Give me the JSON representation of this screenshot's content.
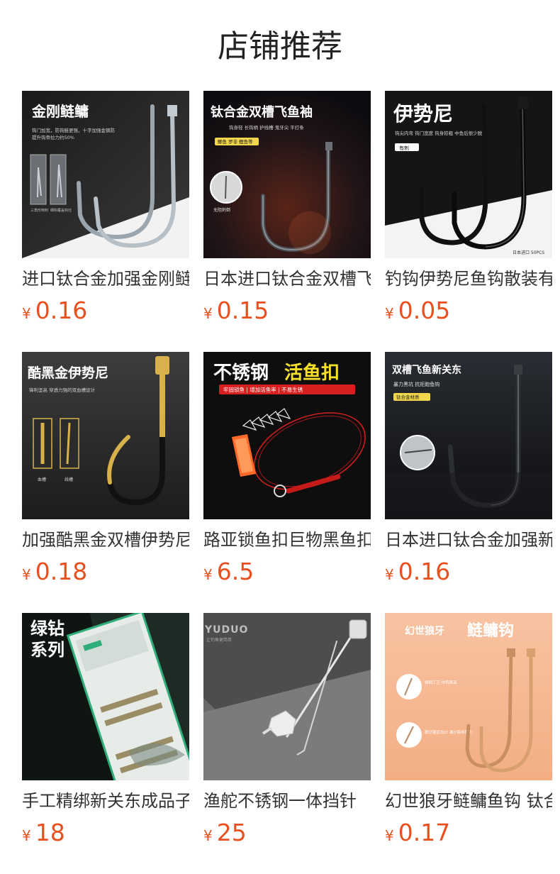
{
  "page": {
    "title": "店铺推荐",
    "currency_symbol": "¥"
  },
  "products": [
    {
      "name": "进口钛合金加强金刚鲢鳙",
      "price": "0.16",
      "image": {
        "title": "金刚鲢鳙",
        "subtitle_1": "钩门加宽，防钩鲢更强，十字加强金钢防",
        "subtitle_2": "提升钩骨拉力约50%",
        "callout_left": "三角形倒刺",
        "callout_right": "细钩覆盖钩坯",
        "colors": {
          "bg": "#1c1c1c",
          "accent": "#9aa5ad"
        }
      }
    },
    {
      "name": "日本进口钛合金双槽飞鱼袖",
      "price": "0.15",
      "image": {
        "title": "钛合金双槽飞鱼袖",
        "subtitle_1": "钩身轻 长钩柄 护线槽 鬼牙尖 平打条",
        "tag": "鲫鱼 罗非 鲤鱼等",
        "callout": "无阻刺倒",
        "colors": {
          "bg": "#1a1417",
          "accent": "#f2d64b"
        }
      }
    },
    {
      "name": "钓钩伊势尼鱼钩散装有刺",
      "price": "0.05",
      "image": {
        "title": "伊势尼",
        "subtitle_1": "钩尖内弯 钩门宽度 钩身较粗 中鱼后很少脱钩",
        "tag": "有刺",
        "footnote": "日本进口 50PCS",
        "colors": {
          "bg": "#f2f2f2",
          "accent": "#111111"
        }
      }
    },
    {
      "name": "加强酷黑金双槽伊势尼鱼钩",
      "price": "0.18",
      "image": {
        "title": "酷黑金伊势尼",
        "subtitle_1": "锋利坚高 穿透力强的双血槽设计",
        "callout_left": "血槽",
        "callout_right": "线槽",
        "colors": {
          "bg": "#2a2a2a",
          "accent": "#d9b14a"
        }
      }
    },
    {
      "name": "路亚锁鱼扣巨物黑鱼扣",
      "price": "6.5",
      "image": {
        "title_part_1": "不锈钢",
        "title_part_2": "活鱼扣",
        "subtitle_1": "牢固锁鱼 | 增加活鱼率 | 不易生锈",
        "colors": {
          "bg": "#0d0d0d",
          "accent": "#f6e02a",
          "red": "#d6201f"
        }
      }
    },
    {
      "name": "日本进口钛合金加强新关东",
      "price": "0.16",
      "image": {
        "title": "双槽飞鱼新关东",
        "subtitle_1": "暴力黑坑 抗拒跑鱼钩",
        "tag": "钛合金材质",
        "colors": {
          "bg": "#15181d",
          "accent": "#f2d64b"
        }
      }
    },
    {
      "name": "手工精绑新关东成品子线",
      "price": "18",
      "image": {
        "title_line_1": "绿钻",
        "title_line_2": "系列",
        "colors": {
          "bg": "#0f1a16",
          "accent": "#2fae7a"
        }
      }
    },
    {
      "name": "渔舵不锈钢一体挡针",
      "price": "25",
      "image": {
        "logo": "YUDUO",
        "logo_sub": "让钓鱼更简单",
        "colors": {
          "bg": "#5a5a5a",
          "accent": "#e6e6e6"
        }
      }
    },
    {
      "name": "幻世狼牙鲢鳙鱼钩 钛合金",
      "price": "0.17",
      "image": {
        "title_part_1": "幻世狼牙",
        "title_part_2": "鲢鳙钩",
        "callout_top": "倒刺工艺 中钩率高",
        "callout_bottom": "狼牙锯齿设计 减小钩丝阻力",
        "colors": {
          "bg": "#f3b48d",
          "accent": "#d9a06f"
        }
      }
    }
  ]
}
